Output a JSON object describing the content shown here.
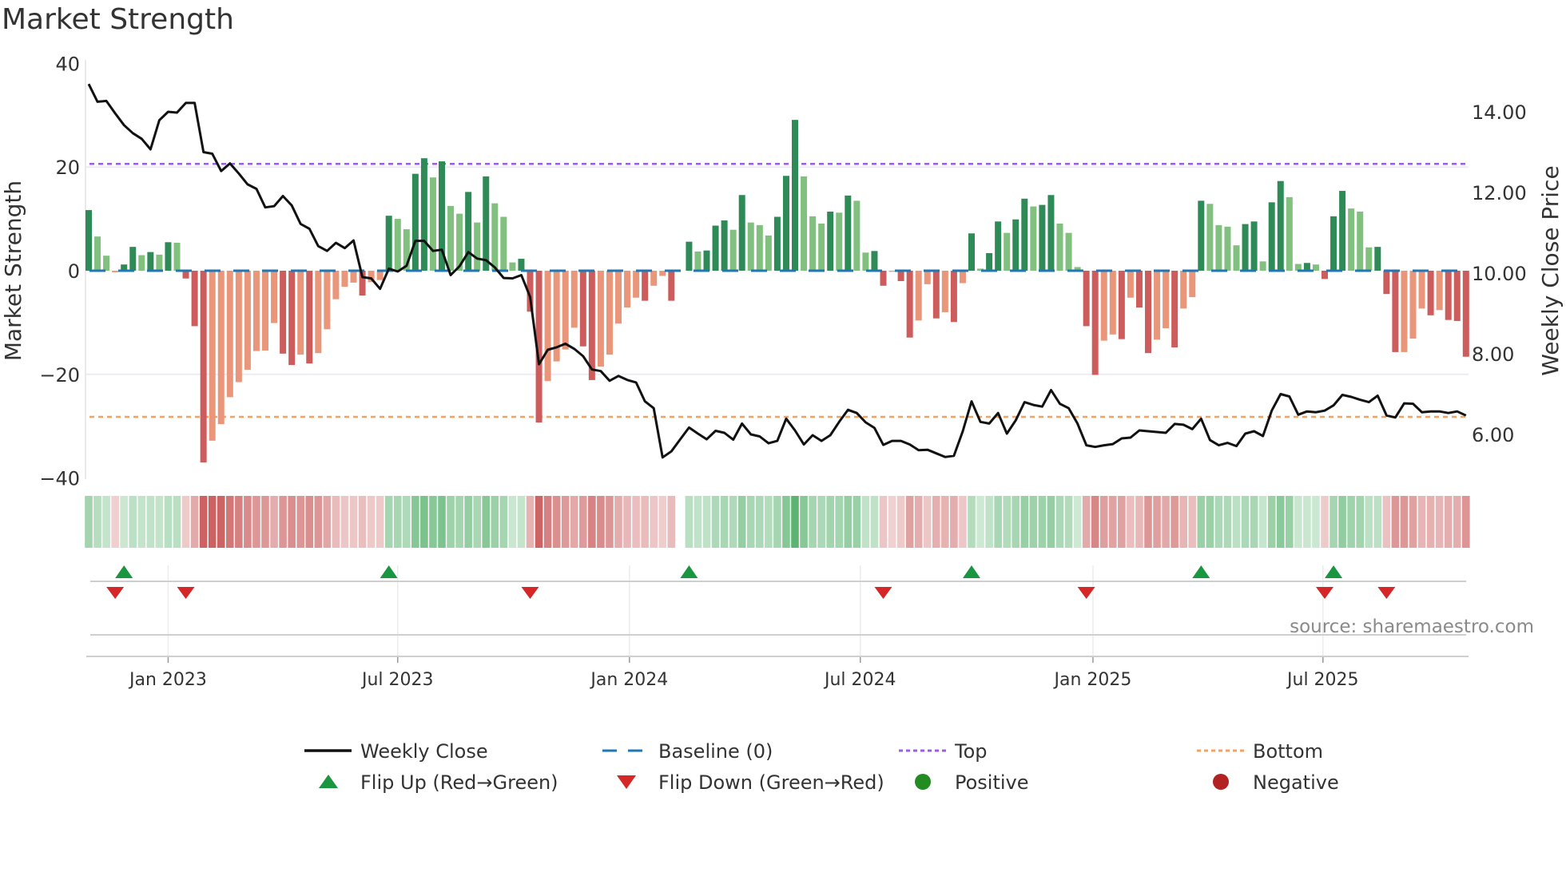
{
  "chart_data": {
    "type": "bar+line",
    "title": "Market Strength",
    "ylabel": "Market Strength",
    "y2label": "Weekly Close Price",
    "source": "source: sharemaestro.com",
    "ylim": [
      -40,
      40
    ],
    "y2lim": [
      4.7,
      15.3
    ],
    "yticks": [
      "40",
      "20",
      "0",
      "−20",
      "−40"
    ],
    "ytick_values": [
      40,
      20,
      0,
      -20,
      -40
    ],
    "y2ticks": [
      "14.00",
      "12.00",
      "10.00",
      "8.00",
      "6.00"
    ],
    "y2tick_values": [
      14,
      12,
      10,
      8,
      6
    ],
    "top_level": 20.6,
    "bottom_level": -28.2,
    "xticks": [
      {
        "label": "Jan 2023",
        "week": 9
      },
      {
        "label": "Jul 2023",
        "week": 35
      },
      {
        "label": "Jan 2024",
        "week": 61.25
      },
      {
        "label": "Jul 2024",
        "week": 87.4
      },
      {
        "label": "Jan 2025",
        "week": 113.75
      },
      {
        "label": "Jul 2025",
        "week": 139.8
      }
    ],
    "strength": [
      11.7,
      6.6,
      2.9,
      -0.3,
      1.2,
      4.6,
      3.0,
      3.6,
      3.1,
      5.5,
      5.4,
      -1.5,
      -10.7,
      -37,
      -32.8,
      -29.6,
      -24.4,
      -21.5,
      -19.1,
      -15.5,
      -15.4,
      -10.1,
      -16.0,
      -18.2,
      -16.2,
      -17.9,
      -15.9,
      -11.3,
      -5.5,
      -3.1,
      -2.3,
      -4.8,
      -2.2,
      -1.8,
      10.6,
      10.0,
      8.0,
      18.7,
      21.7,
      18.0,
      21.1,
      12.5,
      11.0,
      15.2,
      9.3,
      18.2,
      13.0,
      10.4,
      1.6,
      2.3,
      -7.9,
      -29.3,
      -21.3,
      -17.5,
      -15.2,
      -11.0,
      -14.6,
      -21.1,
      -18.5,
      -16.2,
      -10.2,
      -7.1,
      -5.2,
      -5.8,
      -2.9,
      -1.0,
      -5.8,
      0,
      5.6,
      3.7,
      3.9,
      8.7,
      9.7,
      7.9,
      14.6,
      9.3,
      8.8,
      6.8,
      10.4,
      18.3,
      29.1,
      18.2,
      10.5,
      9.1,
      11.4,
      11.2,
      14.5,
      13.5,
      3.5,
      3.8,
      -2.9,
      -0.2,
      -2.0,
      -12.9,
      -9.6,
      -2.6,
      -9.2,
      -8.0,
      -9.9,
      -2.4,
      7.2,
      0.4,
      3.4,
      9.5,
      7.3,
      9.9,
      13.9,
      12.4,
      12.7,
      14.6,
      9.1,
      7.3,
      0.7,
      -10.7,
      -20.1,
      -13.5,
      -12.3,
      -13.2,
      -5.2,
      -7.1,
      -15.9,
      -13.3,
      -11.1,
      -14.8,
      -7.3,
      -5.1,
      13.5,
      12.9,
      8.8,
      8.5,
      4.9,
      9.0,
      9.5,
      1.8,
      13.2,
      17.3,
      14.2,
      1.3,
      1.5,
      1.2,
      -1.6,
      10.5,
      15.4,
      12.0,
      11.4,
      4.5,
      4.6,
      -4.5,
      -15.7,
      -15.7,
      -13.1,
      -7.3,
      -8.6,
      -7.6,
      -9.5,
      -9.7,
      -16.6
    ],
    "strong": [
      1,
      0,
      0,
      0,
      1,
      1,
      0,
      1,
      0,
      1,
      0,
      1,
      1,
      1,
      0,
      0,
      0,
      0,
      0,
      0,
      0,
      0,
      1,
      1,
      0,
      1,
      0,
      0,
      0,
      0,
      0,
      1,
      0,
      0,
      1,
      0,
      0,
      1,
      1,
      0,
      1,
      0,
      0,
      1,
      0,
      1,
      0,
      0,
      0,
      1,
      1,
      1,
      0,
      0,
      0,
      0,
      1,
      1,
      0,
      0,
      0,
      0,
      0,
      1,
      0,
      0,
      1,
      0,
      1,
      0,
      1,
      1,
      1,
      0,
      1,
      0,
      0,
      0,
      1,
      1,
      1,
      0,
      0,
      0,
      1,
      0,
      1,
      0,
      0,
      1,
      1,
      0,
      1,
      1,
      0,
      0,
      1,
      0,
      1,
      0,
      1,
      0,
      1,
      1,
      0,
      1,
      1,
      0,
      1,
      1,
      0,
      0,
      0,
      1,
      1,
      0,
      0,
      1,
      0,
      1,
      1,
      0,
      0,
      1,
      0,
      0,
      1,
      0,
      0,
      0,
      0,
      1,
      1,
      0,
      1,
      1,
      0,
      0,
      1,
      0,
      1,
      1,
      1,
      0,
      0,
      0,
      1,
      1,
      1,
      0,
      0,
      0,
      1,
      0,
      1,
      1,
      1
    ],
    "weekly_close": [
      14.69,
      14.25,
      14.27,
      13.96,
      13.67,
      13.47,
      13.33,
      13.07,
      13.79,
      14.0,
      13.98,
      14.22,
      14.22,
      13.0,
      12.96,
      12.53,
      12.72,
      12.47,
      12.2,
      12.09,
      11.63,
      11.66,
      11.91,
      11.68,
      11.22,
      11.1,
      10.67,
      10.55,
      10.75,
      10.62,
      10.81,
      9.9,
      9.87,
      9.61,
      10.11,
      10.04,
      10.18,
      10.8,
      10.8,
      10.55,
      10.58,
      9.95,
      10.17,
      10.52,
      10.36,
      10.32,
      10.14,
      9.88,
      9.87,
      9.95,
      9.41,
      7.74,
      8.1,
      8.16,
      8.25,
      8.12,
      7.94,
      7.61,
      7.57,
      7.33,
      7.45,
      7.35,
      7.29,
      6.82,
      6.65,
      5.43,
      5.58,
      5.88,
      6.17,
      6.02,
      5.88,
      6.09,
      6.04,
      5.87,
      6.27,
      6.0,
      5.95,
      5.78,
      5.84,
      6.39,
      6.1,
      5.75,
      5.98,
      5.84,
      5.98,
      6.31,
      6.61,
      6.53,
      6.3,
      6.16,
      5.74,
      5.84,
      5.84,
      5.75,
      5.61,
      5.62,
      5.53,
      5.44,
      5.47,
      6.08,
      6.82,
      6.31,
      6.27,
      6.53,
      6.02,
      6.35,
      6.8,
      6.73,
      6.69,
      7.1,
      6.76,
      6.65,
      6.27,
      5.73,
      5.69,
      5.73,
      5.76,
      5.9,
      5.92,
      6.1,
      6.08,
      6.06,
      6.04,
      6.26,
      6.24,
      6.13,
      6.39,
      5.86,
      5.73,
      5.79,
      5.71,
      6.02,
      6.08,
      5.96,
      6.59,
      7.0,
      6.94,
      6.49,
      6.57,
      6.55,
      6.59,
      6.72,
      6.98,
      6.93,
      6.86,
      6.8,
      6.96,
      6.47,
      6.42,
      6.77,
      6.76,
      6.55,
      6.57,
      6.57,
      6.53,
      6.57,
      6.47
    ],
    "flip_up_weeks": [
      4,
      34,
      68,
      100,
      126,
      141
    ],
    "flip_down_weeks": [
      3,
      11,
      50,
      90,
      113,
      140,
      147
    ],
    "legend": [
      {
        "label": "Weekly Close",
        "kind": "line",
        "color": "#111111"
      },
      {
        "label": "Baseline (0)",
        "kind": "dash",
        "color": "#1f77b4"
      },
      {
        "label": "Top",
        "kind": "dot",
        "color": "#9b5de5"
      },
      {
        "label": "Bottom",
        "kind": "dot",
        "color": "#f4a261"
      },
      {
        "label": "Flip Up (Red→Green)",
        "kind": "tri-up",
        "color": "#1a9641"
      },
      {
        "label": "Flip Down (Green→Red)",
        "kind": "tri-down",
        "color": "#d62728"
      },
      {
        "label": "Positive",
        "kind": "circle",
        "color": "#228b22"
      },
      {
        "label": "Negative",
        "kind": "circle",
        "color": "#b22222"
      }
    ],
    "legend_position": "bottom-center",
    "colors": {
      "pos_strong": "#2e8b57",
      "pos_weak": "#81c07f",
      "neg_strong": "#cd5c5c",
      "neg_weak": "#e9967a",
      "price": "#111111",
      "grid": "#ececf2"
    }
  }
}
